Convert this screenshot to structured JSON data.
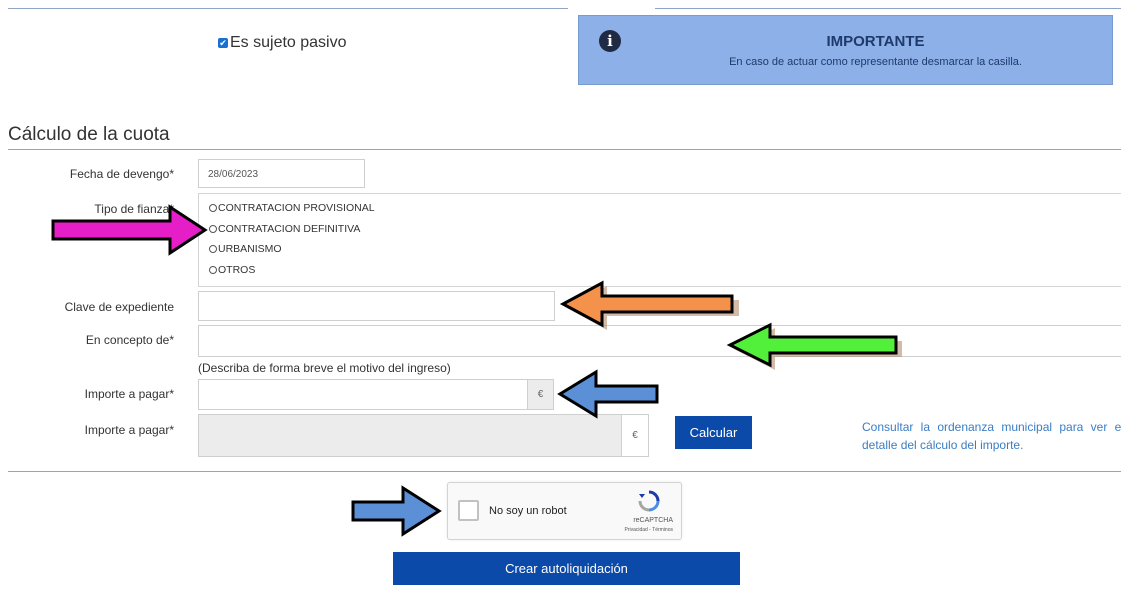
{
  "passive_subject": {
    "label": "Es sujeto pasivo",
    "checked": true
  },
  "notice": {
    "title": "IMPORTANTE",
    "text": "En caso de actuar como representante desmarcar la casilla.",
    "icon": "info-icon"
  },
  "section": {
    "title": "Cálculo de la cuota"
  },
  "form": {
    "fecha_label": "Fecha de devengo*",
    "fecha_value": "28/06/2023",
    "tipo_label": "Tipo de fianza*",
    "tipo_options": [
      "CONTRATACION PROVISIONAL",
      "CONTRATACION DEFINITIVA",
      "URBANISMO",
      "OTROS"
    ],
    "clave_label": "Clave de expediente",
    "clave_value": "",
    "concepto_label": "En concepto de*",
    "concepto_value": "",
    "concepto_help": "(Describa de forma breve el motivo del ingreso)",
    "importe_label": "Importe a pagar*",
    "importe_value": "",
    "currency": "€",
    "importe2_label": "Importe a pagar*",
    "importe2_value": "",
    "calcular_label": "Calcular",
    "ordenanza_text": "Consultar la ordenanza municipal para ver el detalle del cálculo del importe."
  },
  "captcha": {
    "label": "No soy un robot",
    "brand": "reCAPTCHA",
    "links": "Privacidad - Términos"
  },
  "submit": {
    "label": "Crear autoliquidación"
  },
  "annotations": {
    "arrow_colors": [
      "#e61ec8",
      "#f4914b",
      "#52f03a",
      "#5b8fd6",
      "#5b8fd6"
    ]
  }
}
